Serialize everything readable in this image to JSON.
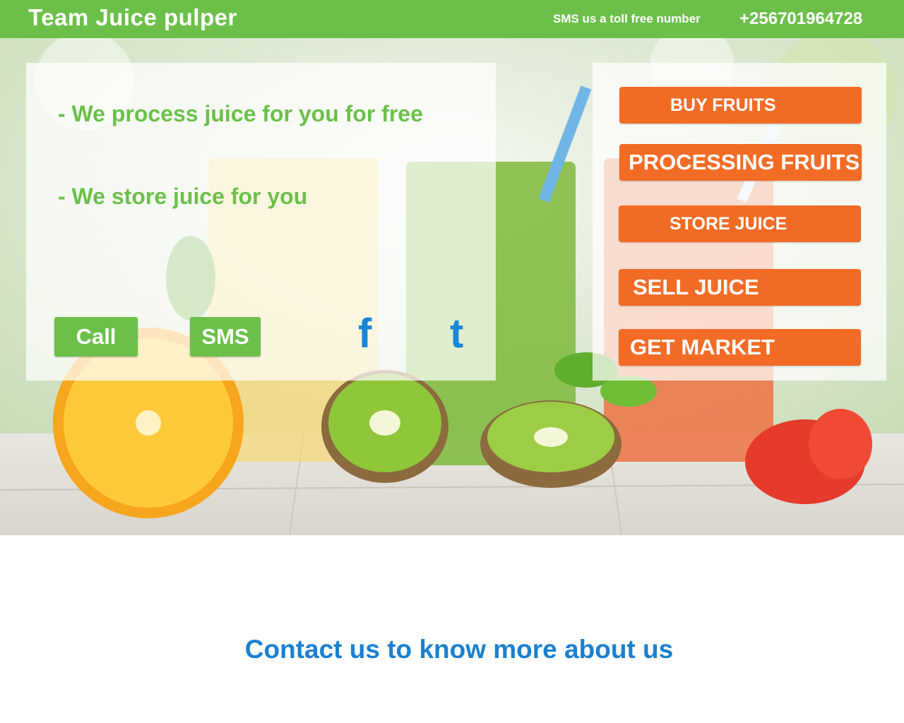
{
  "header": {
    "brand": "Team Juice pulper",
    "sms_text": "SMS us a toll free number",
    "phone": "+256701964728"
  },
  "hero": {
    "bullets": [
      "- We process juice for you for free",
      "- We store juice for you"
    ],
    "buttons": {
      "call": "Call",
      "sms": "SMS"
    },
    "social": {
      "facebook": "f",
      "tumblr": "t"
    },
    "menu": [
      "BUY FRUITS",
      "PROCESSING FRUITS",
      "STORE JUICE",
      "SELL JUICE",
      "GET MARKET"
    ]
  },
  "contact": {
    "heading": "Contact us to know more about us"
  },
  "colors": {
    "green": "#6cc04a",
    "orange": "#f26c26",
    "blue": "#1a80d0"
  }
}
